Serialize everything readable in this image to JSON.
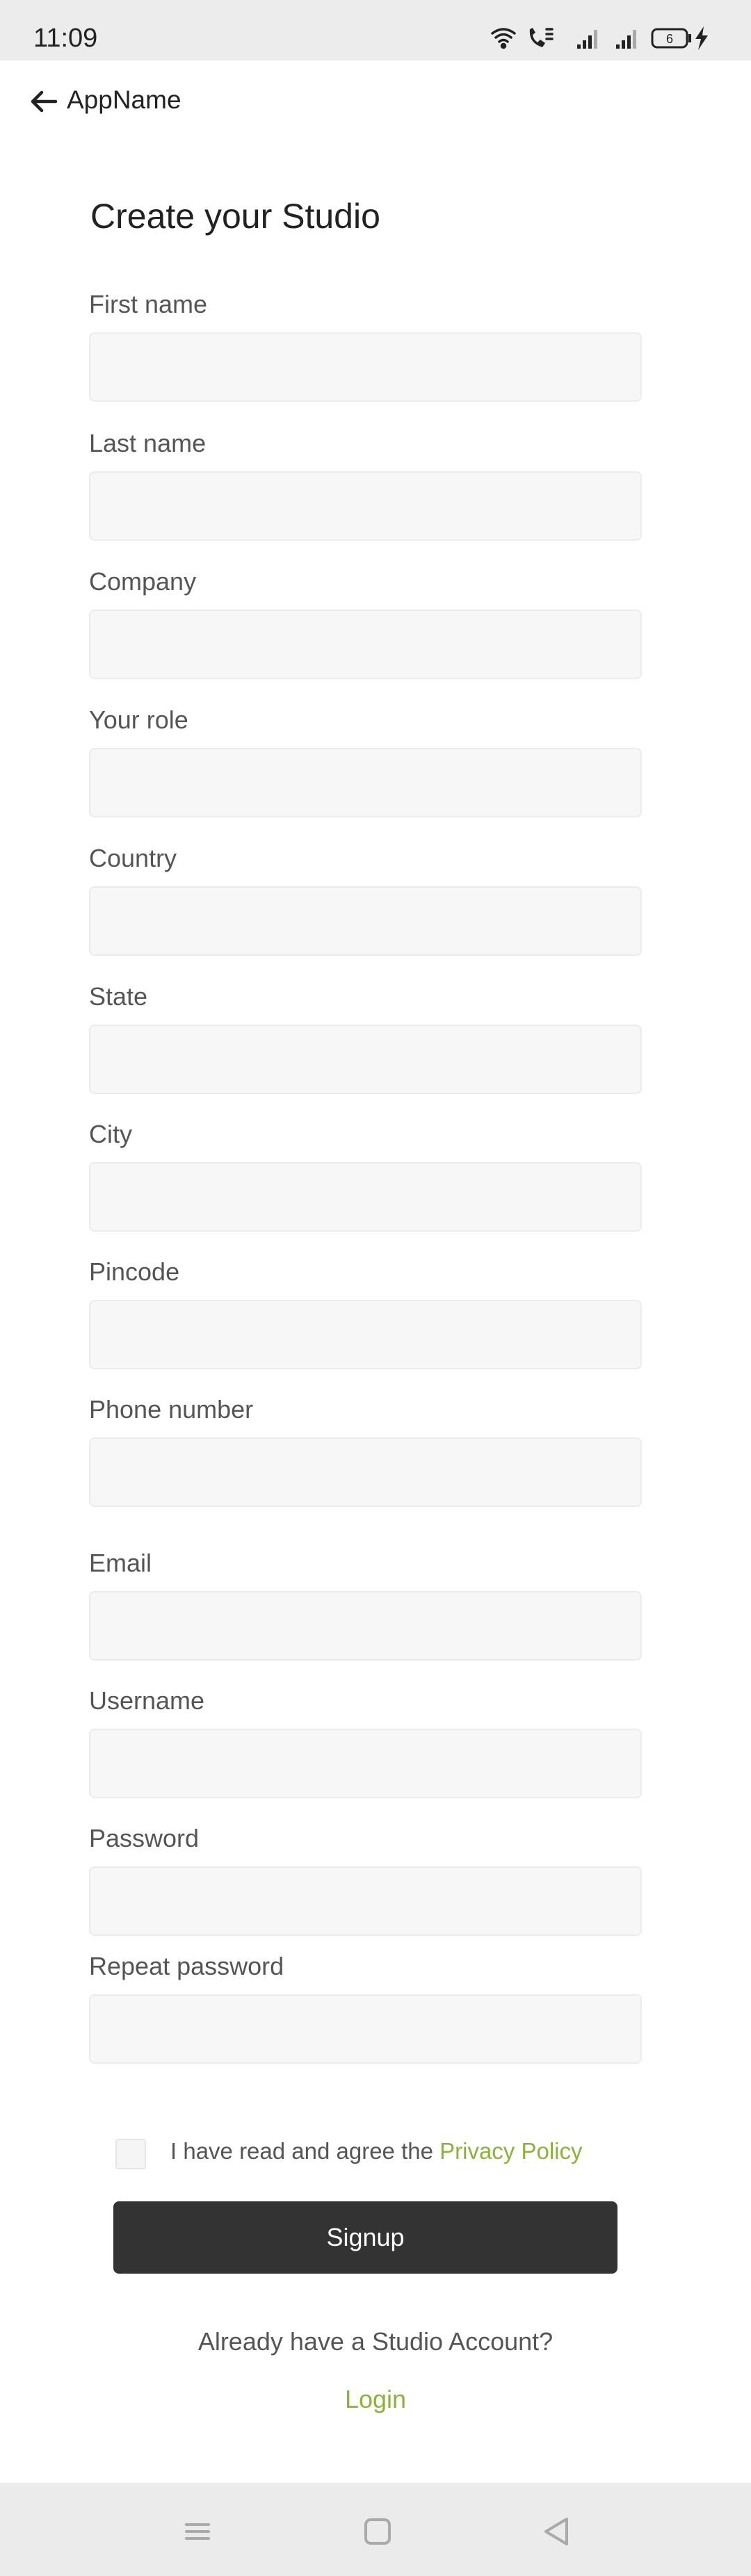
{
  "status_bar": {
    "time": "11:09",
    "battery": "6",
    "icons": [
      "wifi-icon",
      "call-icon",
      "signal-icon",
      "signal-icon",
      "battery-icon",
      "charging-icon"
    ]
  },
  "app_bar": {
    "title": "AppName",
    "back_icon": "arrow-left-icon"
  },
  "form": {
    "title": "Create your Studio",
    "fields": [
      {
        "label": "First name",
        "value": "",
        "placeholder": ""
      },
      {
        "label": "Last name",
        "value": "",
        "placeholder": ""
      },
      {
        "label": "Company",
        "value": "",
        "placeholder": ""
      },
      {
        "label": "Your role",
        "value": "",
        "placeholder": ""
      },
      {
        "label": "Country",
        "value": "",
        "placeholder": ""
      },
      {
        "label": "State",
        "value": "",
        "placeholder": ""
      },
      {
        "label": "City",
        "value": "",
        "placeholder": ""
      },
      {
        "label": "Pincode",
        "value": "",
        "placeholder": ""
      },
      {
        "label": "Phone number",
        "value": "",
        "placeholder": ""
      },
      {
        "label": "Email",
        "value": "",
        "placeholder": ""
      },
      {
        "label": "Username",
        "value": "",
        "placeholder": ""
      },
      {
        "label": "Password",
        "value": "",
        "placeholder": ""
      },
      {
        "label": "Repeat password",
        "value": "",
        "placeholder": ""
      }
    ],
    "agreement": {
      "text": "I have read and agree the",
      "link": "Privacy Policy",
      "checked": false
    },
    "signup_label": "Signup",
    "have_account_text": "Already have a Studio Account?",
    "login_label": "Login"
  },
  "nav_bar": {
    "buttons": [
      "menu-icon",
      "home-square-icon",
      "back-triangle-icon"
    ]
  },
  "colors": {
    "accent": "#8bb33a",
    "button_bg": "#333333",
    "input_bg": "#f7f7f7",
    "status_bar_bg": "#ececec",
    "nav_bar_bg": "#ebebeb"
  }
}
